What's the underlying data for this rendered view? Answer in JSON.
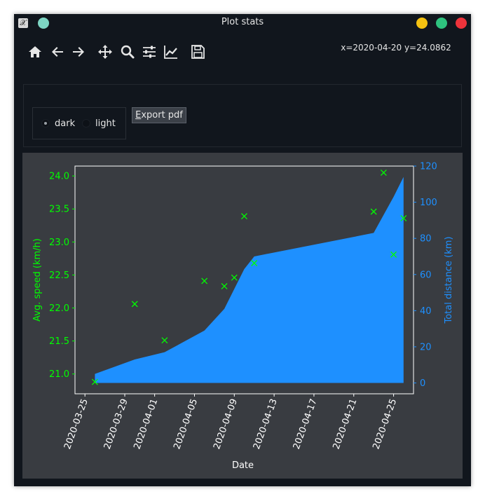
{
  "window": {
    "title": "Plot stats"
  },
  "toolbar": {
    "tools": [
      "home-icon",
      "back-icon",
      "forward-icon",
      "pan-icon",
      "zoom-icon",
      "subplots-icon",
      "customize-icon",
      "save-icon"
    ],
    "coords": "x=2020-04-20 y=24.0862"
  },
  "theme": {
    "options": [
      "dark",
      "light"
    ],
    "selected": "dark"
  },
  "export": {
    "label": "Export pdf"
  },
  "colors": {
    "speed": "#00ff00",
    "distance": "#1e90ff",
    "figure_bg": "#393c41",
    "text": "#ffffff"
  },
  "chart_data": {
    "type": "scatter",
    "xlabel": "Date",
    "ylabel_left": "Avg. speed (km/h)",
    "ylabel_right": "Total distance (km)",
    "xlim": [
      "2020-03-24",
      "2020-04-27"
    ],
    "ylim_left": [
      20.7,
      24.15
    ],
    "ylim_right": [
      -6,
      120
    ],
    "x_ticks": [
      "2020-03-25",
      "2020-03-29",
      "2020-04-01",
      "2020-04-05",
      "2020-04-09",
      "2020-04-13",
      "2020-04-17",
      "2020-04-21",
      "2020-04-25"
    ],
    "y_ticks_left": [
      21.0,
      21.5,
      22.0,
      22.5,
      23.0,
      23.5,
      24.0
    ],
    "y_ticks_right": [
      0,
      20,
      40,
      60,
      80,
      100,
      120
    ],
    "grid": false,
    "series": [
      {
        "axis": "left",
        "marker": "x",
        "color": "#00ff00",
        "points": [
          [
            "2020-03-26",
            20.88
          ],
          [
            "2020-03-30",
            22.06
          ],
          [
            "2020-04-02",
            21.51
          ],
          [
            "2020-04-06",
            22.41
          ],
          [
            "2020-04-08",
            22.33
          ],
          [
            "2020-04-09",
            22.46
          ],
          [
            "2020-04-10",
            23.39
          ],
          [
            "2020-04-11",
            22.68
          ],
          [
            "2020-04-23",
            23.46
          ],
          [
            "2020-04-24",
            24.05
          ],
          [
            "2020-04-25",
            22.81
          ],
          [
            "2020-04-26",
            23.36
          ]
        ]
      },
      {
        "axis": "right",
        "type": "area",
        "color": "#1e90ff",
        "points": [
          [
            "2020-03-26",
            5
          ],
          [
            "2020-03-30",
            13
          ],
          [
            "2020-04-02",
            17
          ],
          [
            "2020-04-06",
            29
          ],
          [
            "2020-04-08",
            41
          ],
          [
            "2020-04-09",
            52
          ],
          [
            "2020-04-10",
            63
          ],
          [
            "2020-04-11",
            70
          ],
          [
            "2020-04-23",
            83
          ],
          [
            "2020-04-24",
            93
          ],
          [
            "2020-04-25",
            103
          ],
          [
            "2020-04-26",
            114
          ]
        ]
      }
    ]
  }
}
